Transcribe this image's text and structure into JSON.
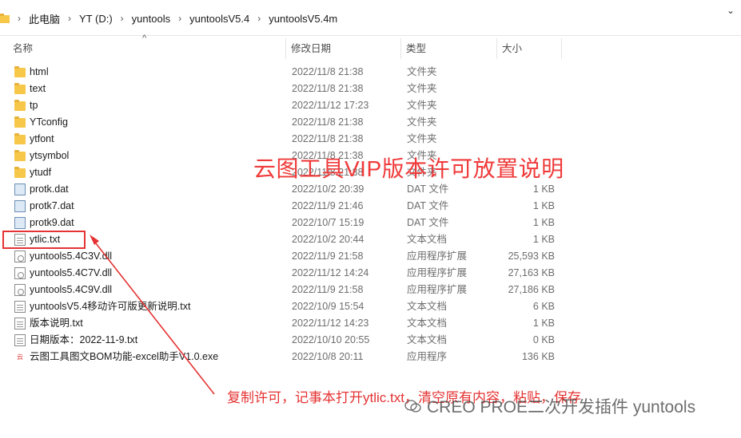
{
  "breadcrumbs": [
    "此电脑",
    "YT (D:)",
    "yuntools",
    "yuntoolsV5.4",
    "yuntoolsV5.4m"
  ],
  "columns": {
    "name": "名称",
    "date": "修改日期",
    "type": "类型",
    "size": "大小"
  },
  "rows": [
    {
      "name": "html",
      "date": "2022/11/8 21:38",
      "type": "文件夹",
      "size": "",
      "icon": "folder-icon"
    },
    {
      "name": "text",
      "date": "2022/11/8 21:38",
      "type": "文件夹",
      "size": "",
      "icon": "folder-icon"
    },
    {
      "name": "tp",
      "date": "2022/11/12 17:23",
      "type": "文件夹",
      "size": "",
      "icon": "folder-icon"
    },
    {
      "name": "YTconfig",
      "date": "2022/11/8 21:38",
      "type": "文件夹",
      "size": "",
      "icon": "folder-icon"
    },
    {
      "name": "ytfont",
      "date": "2022/11/8 21:38",
      "type": "文件夹",
      "size": "",
      "icon": "folder-icon"
    },
    {
      "name": "ytsymbol",
      "date": "2022/11/8 21:38",
      "type": "文件夹",
      "size": "",
      "icon": "folder-icon"
    },
    {
      "name": "ytudf",
      "date": "2022/11/8 21:38",
      "type": "文件夹",
      "size": "",
      "icon": "folder-icon"
    },
    {
      "name": "protk.dat",
      "date": "2022/10/2 20:39",
      "type": "DAT 文件",
      "size": "1 KB",
      "icon": "dat-file-icon"
    },
    {
      "name": "protk7.dat",
      "date": "2022/11/9 21:46",
      "type": "DAT 文件",
      "size": "1 KB",
      "icon": "dat-file-icon"
    },
    {
      "name": "protk9.dat",
      "date": "2022/10/7 15:19",
      "type": "DAT 文件",
      "size": "1 KB",
      "icon": "dat-file-icon"
    },
    {
      "name": "ytlic.txt",
      "date": "2022/10/2 20:44",
      "type": "文本文档",
      "size": "1 KB",
      "icon": "text-file-icon"
    },
    {
      "name": "yuntools5.4C3V.dll",
      "date": "2022/11/9 21:58",
      "type": "应用程序扩展",
      "size": "25,593 KB",
      "icon": "dll-file-icon"
    },
    {
      "name": "yuntools5.4C7V.dll",
      "date": "2022/11/12 14:24",
      "type": "应用程序扩展",
      "size": "27,163 KB",
      "icon": "dll-file-icon"
    },
    {
      "name": "yuntools5.4C9V.dll",
      "date": "2022/11/9 21:58",
      "type": "应用程序扩展",
      "size": "27,186 KB",
      "icon": "dll-file-icon"
    },
    {
      "name": "yuntoolsV5.4移动许可版更新说明.txt",
      "date": "2022/10/9 15:54",
      "type": "文本文档",
      "size": "6 KB",
      "icon": "text-file-icon"
    },
    {
      "name": "版本说明.txt",
      "date": "2022/11/12 14:23",
      "type": "文本文档",
      "size": "1 KB",
      "icon": "text-file-icon"
    },
    {
      "name": "日期版本：2022-11-9.txt",
      "date": "2022/10/10 20:55",
      "type": "文本文档",
      "size": "0 KB",
      "icon": "text-file-icon"
    },
    {
      "name": "云图工具图文BOM功能-excel助手V1.0.exe",
      "date": "2022/10/8 20:11",
      "type": "应用程序",
      "size": "136 KB",
      "icon": "exe-file-icon"
    }
  ],
  "annotations": {
    "title": "云图工具VIP版本许可放置说明",
    "note": "复制许可，记事本打开ytlic.txt，清空原有内容，粘贴，保存",
    "watermark": "CREO PROE二次开发插件 yuntools"
  },
  "colors": {
    "accent_red": "#e53333",
    "folder": "#f6c748"
  }
}
